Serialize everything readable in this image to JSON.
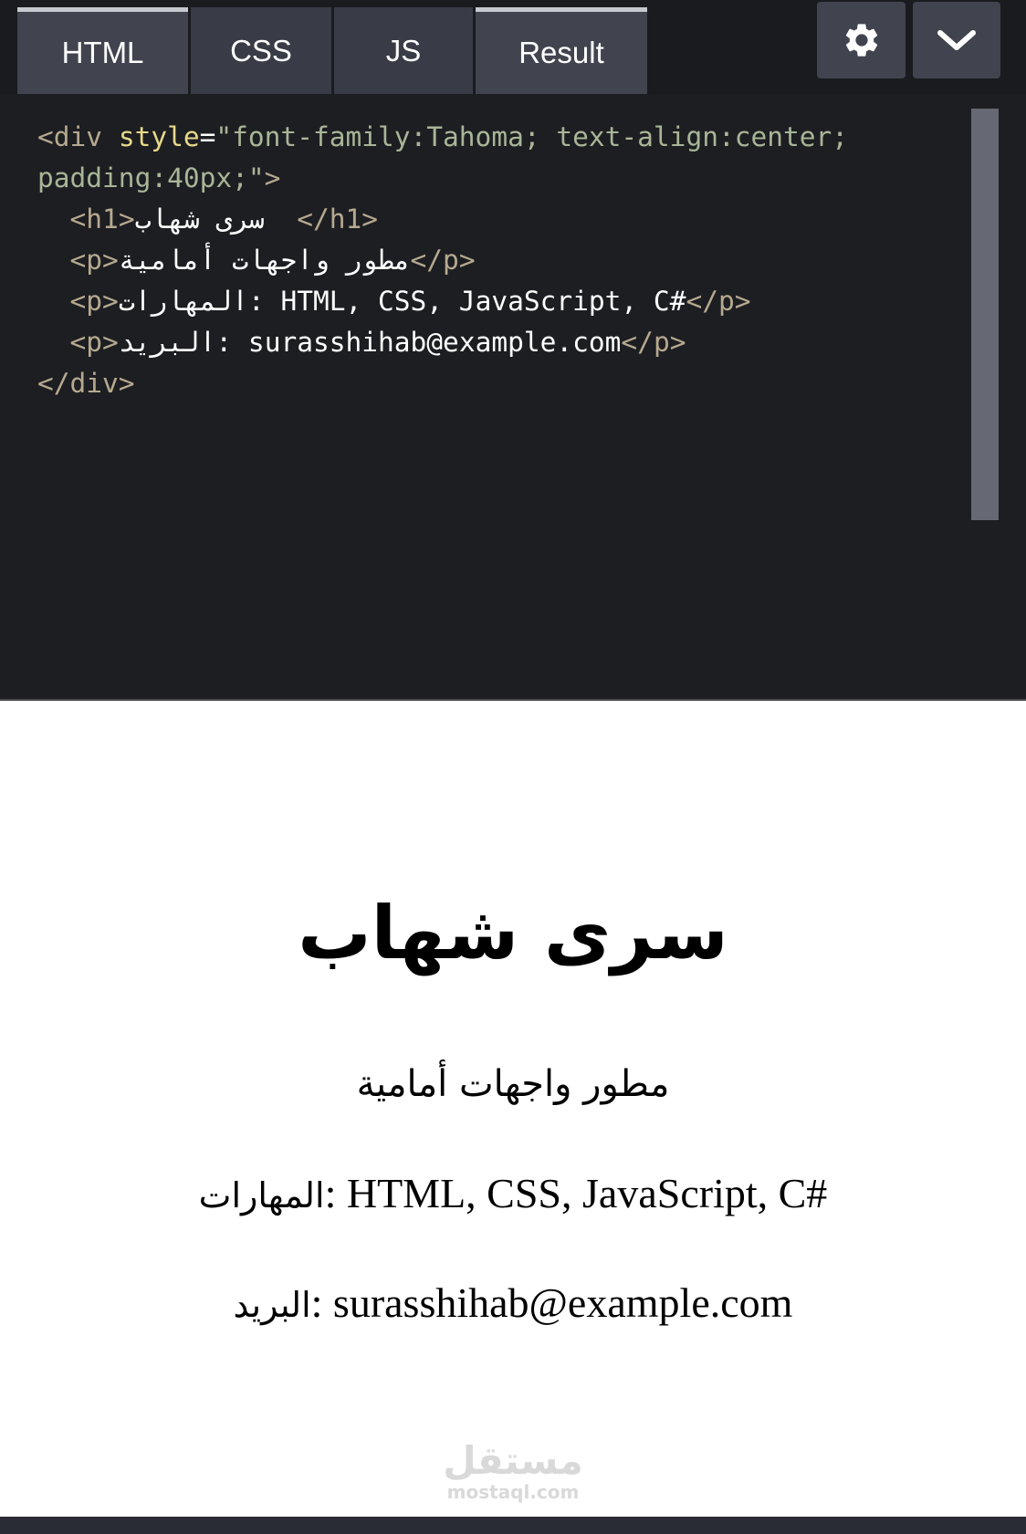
{
  "tabs": [
    {
      "label": "HTML"
    },
    {
      "label": "CSS"
    },
    {
      "label": "JS"
    },
    {
      "label": "Result"
    }
  ],
  "toolbar": {
    "settings_icon": "gear-icon",
    "collapse_icon": "chevron-down-icon"
  },
  "editor": {
    "lines": [
      {
        "open": "<div ",
        "attr": "style",
        "eq": "=",
        "str": "\"font-family:Tahoma; text-align:center;"
      },
      {
        "str": "padding:40px;\"",
        "close": ">"
      },
      {
        "open": "<h1>",
        "text": "سرى شهاب  ",
        "close": "</h1>"
      },
      {
        "open": "<p>",
        "text": "مطور واجهات أمامية",
        "close": "</p>"
      },
      {
        "open": "<p>",
        "text": "المهارات: HTML, CSS, JavaScript, C#",
        "close": "</p>"
      },
      {
        "open": "<p>",
        "text": "البريد: surasshihab@example.com",
        "close": "</p>"
      },
      {
        "close": "</div>"
      }
    ]
  },
  "result": {
    "title": "سرى شهاب",
    "subtitle": "مطور واجهات أمامية",
    "skills_label": "المهارات",
    "skills_value": ": HTML, CSS, JavaScript, C#",
    "email_label": "البريد",
    "email_value": ": surasshihab@example.com"
  },
  "watermark": {
    "arabic": "مستقل",
    "latin": "mostaql.com"
  },
  "colors": {
    "background": "#1d1e22",
    "tab": "#393c47",
    "tag": "#b6a98f",
    "attr": "#e7d98a",
    "string": "#a9b597"
  }
}
